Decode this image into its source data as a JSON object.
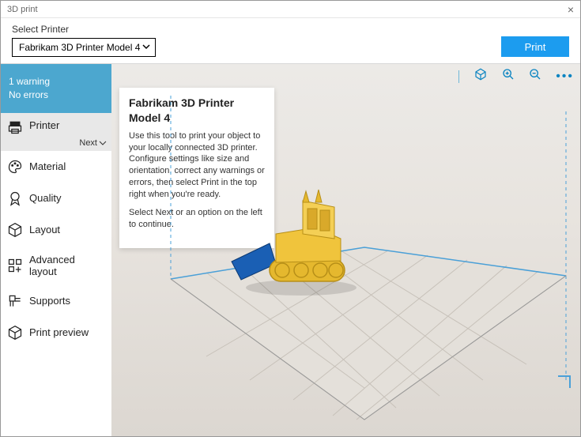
{
  "window": {
    "title": "3D print"
  },
  "topbar": {
    "selector_label": "Select Printer",
    "selected_printer": "Fabrikam 3D Printer Model 4",
    "print_label": "Print"
  },
  "status": {
    "warnings": "1 warning",
    "errors": "No errors"
  },
  "sidebar": {
    "items": [
      {
        "label": "Printer"
      },
      {
        "label": "Material"
      },
      {
        "label": "Quality"
      },
      {
        "label": "Layout"
      },
      {
        "label": "Advanced layout"
      },
      {
        "label": "Supports"
      },
      {
        "label": "Print preview"
      }
    ],
    "next_label": "Next"
  },
  "tooltip": {
    "title": "Fabrikam 3D Printer Model 4",
    "body1": "Use this tool to print your object to your locally connected 3D printer. Configure settings like size and orientation, correct any warnings or errors, then select Print in the top right when you're ready.",
    "body2": "Select Next or an option on the left to continue."
  }
}
